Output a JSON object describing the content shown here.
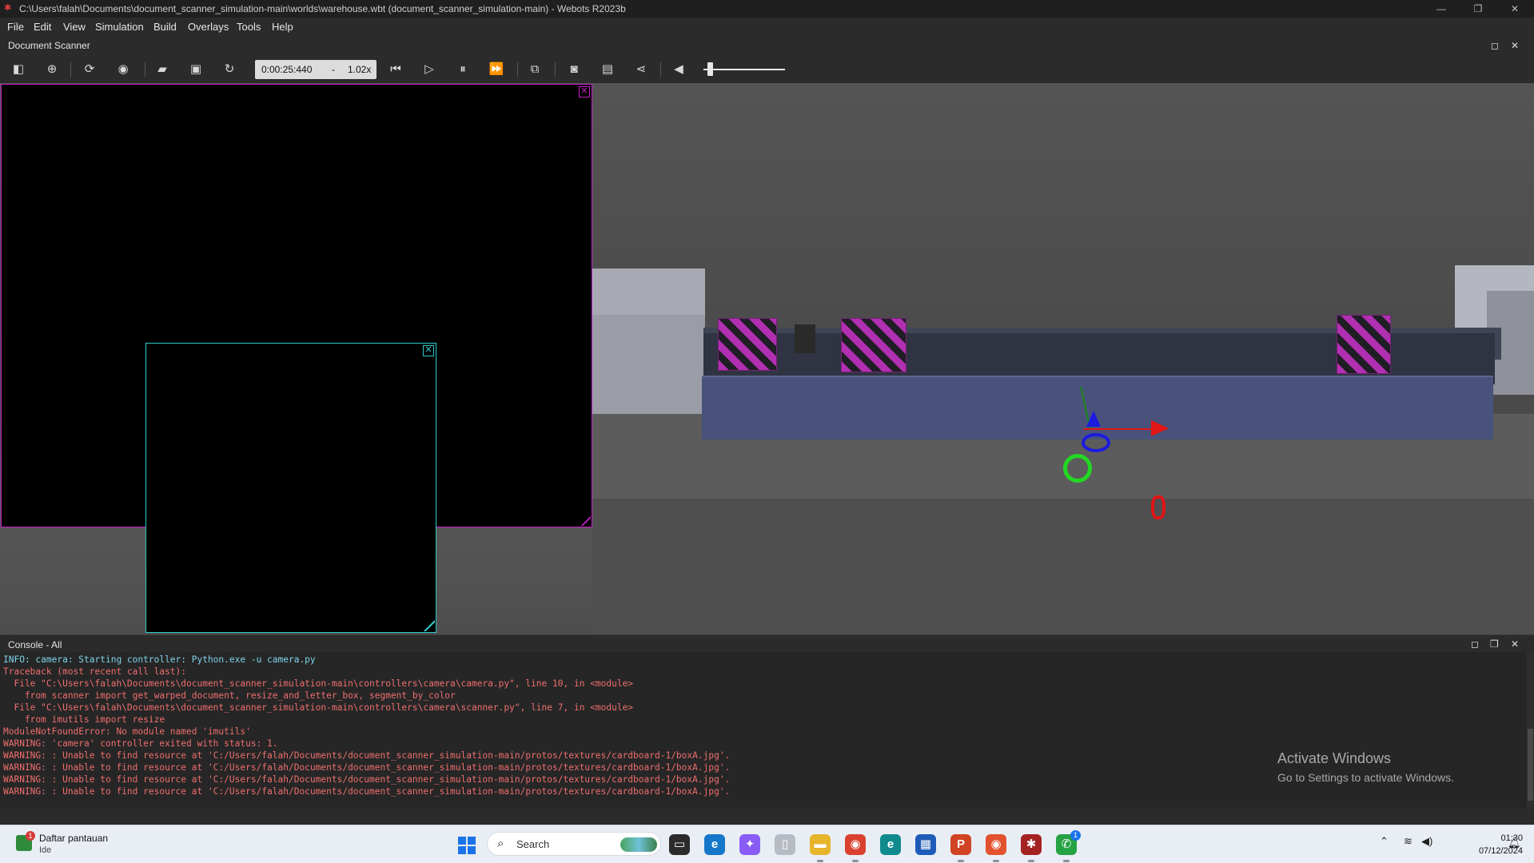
{
  "window": {
    "title": "C:\\Users\\falah\\Documents\\document_scanner_simulation-main\\worlds\\warehouse.wbt (document_scanner_simulation-main) - Webots R2023b",
    "controls": {
      "minimize": "—",
      "restore": "❐",
      "close": "✕"
    }
  },
  "menu": [
    "File",
    "Edit",
    "View",
    "Simulation",
    "Build",
    "Overlays",
    "Tools",
    "Help"
  ],
  "document": {
    "title": "Document Scanner"
  },
  "toolbar": {
    "time": "0:00:25:440",
    "dash": "-",
    "speed": "1.02x",
    "icons": [
      "scene-tree-toggle-icon",
      "add-node-icon",
      "reload-view-icon",
      "eye-icon",
      "open-world-icon",
      "save-world-icon",
      "reload-world-icon",
      "reset-simulation-icon",
      "step-icon",
      "pause-icon",
      "fast-forward-icon",
      "view-3d-icon",
      "screenshot-icon",
      "movie-icon",
      "share-icon",
      "volume-icon"
    ],
    "volume_level": 0.05
  },
  "console": {
    "title": "Console - All",
    "lines": [
      {
        "kind": "info",
        "text": "INFO: camera: Starting controller: Python.exe -u camera.py"
      },
      {
        "kind": "err",
        "text": "Traceback (most recent call last):"
      },
      {
        "kind": "err",
        "text": "  File \"C:\\Users\\falah\\Documents\\document_scanner_simulation-main\\controllers\\camera\\camera.py\", line 10, in <module>"
      },
      {
        "kind": "err",
        "text": "    from scanner import get_warped_document, resize_and_letter_box, segment_by_color"
      },
      {
        "kind": "err",
        "text": "  File \"C:\\Users\\falah\\Documents\\document_scanner_simulation-main\\controllers\\camera\\scanner.py\", line 7, in <module>"
      },
      {
        "kind": "err",
        "text": "    from imutils import resize"
      },
      {
        "kind": "err",
        "text": "ModuleNotFoundError: No module named 'imutils'"
      },
      {
        "kind": "warn",
        "text": "WARNING: 'camera' controller exited with status: 1."
      },
      {
        "kind": "warn",
        "text": "WARNING: : Unable to find resource at 'C:/Users/falah/Documents/document_scanner_simulation-main/protos/textures/cardboard-1/boxA.jpg'."
      },
      {
        "kind": "warn",
        "text": "WARNING: : Unable to find resource at 'C:/Users/falah/Documents/document_scanner_simulation-main/protos/textures/cardboard-1/boxA.jpg'."
      },
      {
        "kind": "warn",
        "text": "WARNING: : Unable to find resource at 'C:/Users/falah/Documents/document_scanner_simulation-main/protos/textures/cardboard-1/boxA.jpg'."
      },
      {
        "kind": "warn",
        "text": "WARNING: : Unable to find resource at 'C:/Users/falah/Documents/document_scanner_simulation-main/protos/textures/cardboard-1/boxA.jpg'."
      }
    ]
  },
  "activate": {
    "line1": "Activate Windows",
    "line2": "Go to Settings to activate Windows."
  },
  "taskbar": {
    "watchlist": {
      "badge": "1",
      "title": "Daftar pantauan",
      "subtitle": "Ide"
    },
    "search_label": "Search",
    "apps": [
      {
        "name": "task-view-icon",
        "glyph": "▭",
        "color": "#2b2b2b"
      },
      {
        "name": "edge-icon",
        "glyph": "e",
        "color": "#1577c9"
      },
      {
        "name": "copilot-icon",
        "glyph": "✦",
        "color": "#8a5cf6"
      },
      {
        "name": "file-icon",
        "glyph": "▯",
        "color": "#b7bcc4"
      },
      {
        "name": "file-explorer-icon",
        "glyph": "▬",
        "color": "#e7b52c"
      },
      {
        "name": "chrome-icon",
        "glyph": "◉",
        "color": "#d9412e"
      },
      {
        "name": "edge-dev-icon",
        "glyph": "e",
        "color": "#0f8b8d"
      },
      {
        "name": "store-icon",
        "glyph": "▦",
        "color": "#1e5bb8"
      },
      {
        "name": "powerpoint-icon",
        "glyph": "P",
        "color": "#d04423"
      },
      {
        "name": "chrome-profile-icon",
        "glyph": "◉",
        "color": "#e2522f"
      },
      {
        "name": "webots-icon",
        "glyph": "✱",
        "color": "#a52222"
      },
      {
        "name": "whatsapp-icon",
        "glyph": "✆",
        "color": "#25a244"
      }
    ],
    "whatsapp_badge": "1",
    "clock": {
      "time": "01:30",
      "date": "07/12/2024"
    }
  }
}
